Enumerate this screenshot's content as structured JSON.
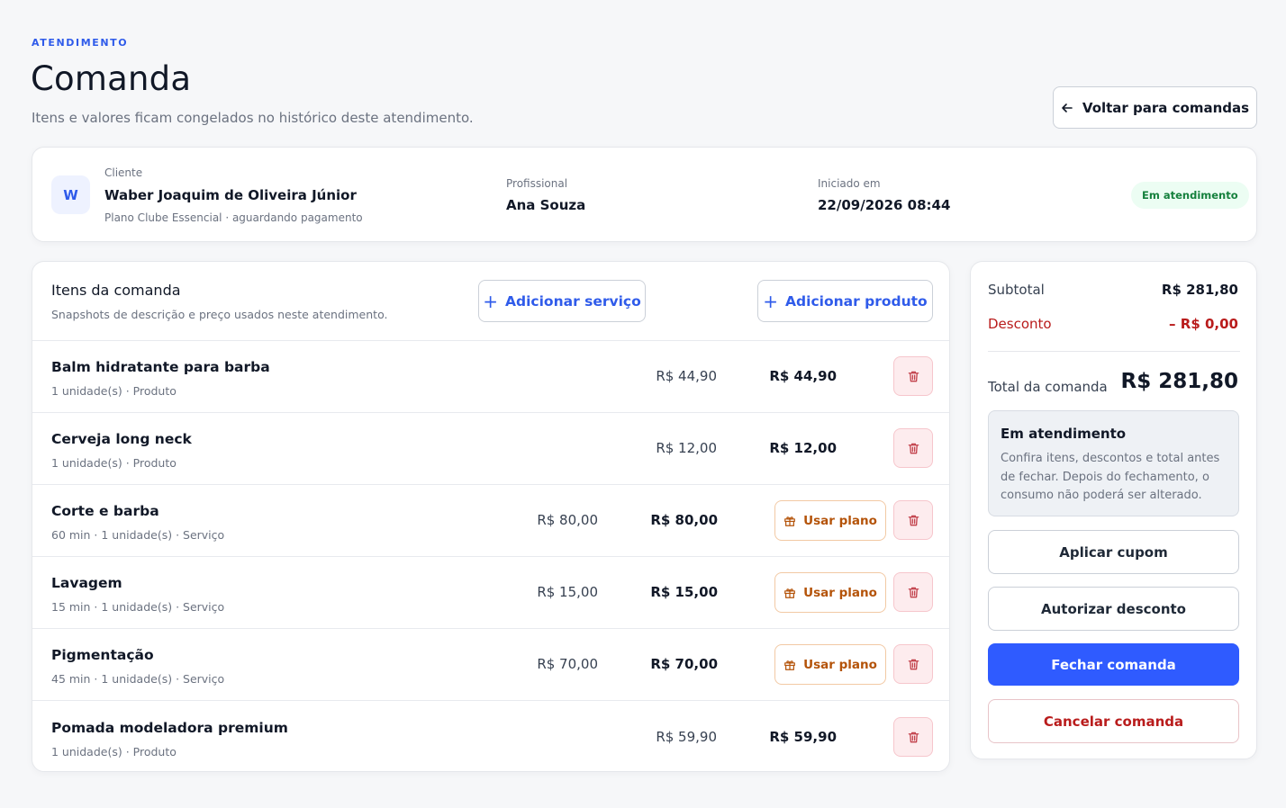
{
  "header": {
    "eyebrow": "ATENDIMENTO",
    "title": "Comanda",
    "subtitle": "Itens e valores ficam congelados no histórico deste atendimento.",
    "back_label": "Voltar para comandas"
  },
  "client": {
    "avatar_initial": "W",
    "client_label": "Cliente",
    "client_name": "Waber Joaquim de Oliveira Júnior",
    "client_note": "Plano Clube Essencial · aguardando pagamento",
    "professional_label": "Profissional",
    "professional_name": "Ana Souza",
    "started_label": "Iniciado em",
    "started_value": "22/09/2026 08:44",
    "status": "Em atendimento"
  },
  "items": {
    "title": "Itens da comanda",
    "subtitle": "Snapshots de descrição e preço usados neste atendimento.",
    "add_service_label": "Adicionar serviço",
    "add_product_label": "Adicionar produto",
    "plan_button_label": "Usar plano",
    "rows": [
      {
        "name": "Balm hidratante para barba",
        "meta": "1 unidade(s) · Produto",
        "unit_price": "R$ 44,90",
        "total": "R$ 44,90",
        "type": "product"
      },
      {
        "name": "Cerveja long neck",
        "meta": "1 unidade(s) · Produto",
        "unit_price": "R$ 12,00",
        "total": "R$ 12,00",
        "type": "product"
      },
      {
        "name": "Corte e barba",
        "meta": "60 min · 1 unidade(s) · Serviço",
        "unit_price": "R$ 80,00",
        "total": "R$ 80,00",
        "type": "service"
      },
      {
        "name": "Lavagem",
        "meta": "15 min · 1 unidade(s) · Serviço",
        "unit_price": "R$ 15,00",
        "total": "R$ 15,00",
        "type": "service"
      },
      {
        "name": "Pigmentação",
        "meta": "45 min · 1 unidade(s) · Serviço",
        "unit_price": "R$ 70,00",
        "total": "R$ 70,00",
        "type": "service"
      },
      {
        "name": "Pomada modeladora premium",
        "meta": "1 unidade(s) · Produto",
        "unit_price": "R$ 59,90",
        "total": "R$ 59,90",
        "type": "product"
      }
    ]
  },
  "summary": {
    "subtotal_label": "Subtotal",
    "subtotal_value": "R$ 281,80",
    "discount_label": "Desconto",
    "discount_value": "– R$ 0,00",
    "total_label": "Total da comanda",
    "total_value": "R$ 281,80",
    "info_title": "Em atendimento",
    "info_text": "Confira itens, descontos e total antes de fechar. Depois do fechamento, o consumo não poderá ser alterado.",
    "coupon_label": "Aplicar cupom",
    "authorize_label": "Autorizar desconto",
    "close_label": "Fechar comanda",
    "cancel_label": "Cancelar comanda"
  },
  "colors": {
    "accent": "#2f5bff",
    "danger": "#b91c1c",
    "plan": "#b45309",
    "status_green": "#15803d"
  }
}
